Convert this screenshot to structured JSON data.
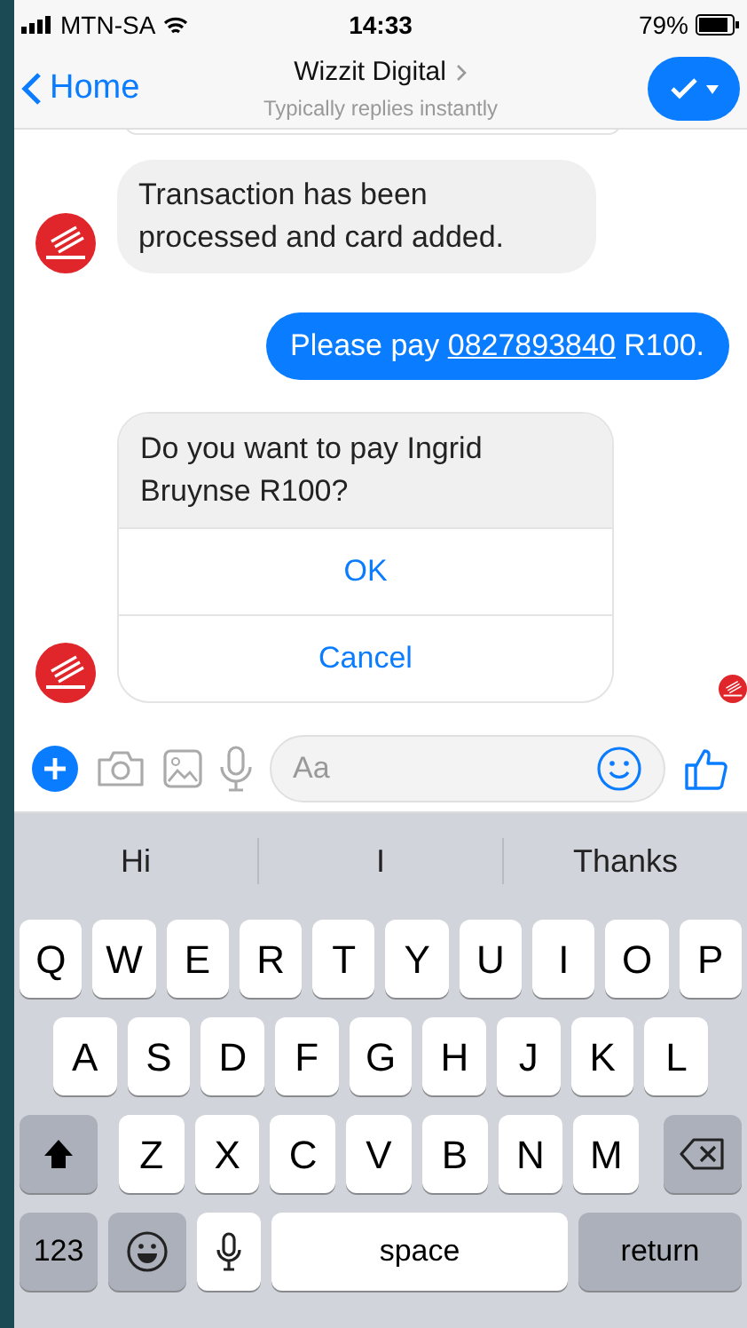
{
  "status_bar": {
    "carrier": "MTN-SA",
    "time": "14:33",
    "battery": "79%"
  },
  "header": {
    "back": "Home",
    "title": "Wizzit Digital",
    "subtitle": "Typically replies instantly"
  },
  "messages": [
    {
      "kind": "cut-card"
    },
    {
      "kind": "received",
      "text": "Transaction has been processed and card added.",
      "avatar": true
    },
    {
      "kind": "sent",
      "text": "Please pay ",
      "link": "0827893840",
      "after": " R100."
    },
    {
      "kind": "card",
      "text": "Do you want to pay Ingrid Bruynse R100?",
      "options": [
        "OK",
        "Cancel"
      ],
      "avatar": true,
      "seen": true
    }
  ],
  "composer": {
    "placeholder": "Aa"
  },
  "keyboard": {
    "suggestions": [
      "Hi",
      "I",
      "Thanks"
    ],
    "letter_rows": [
      {
        "keys": [
          "Q",
          "W",
          "E",
          "R",
          "T",
          "Y",
          "U",
          "I",
          "O",
          "P"
        ]
      },
      {
        "keys": [
          "A",
          "S",
          "D",
          "F",
          "G",
          "H",
          "J",
          "K",
          "L"
        ]
      },
      {
        "keys": [
          "Z",
          "X",
          "C",
          "V",
          "B",
          "N",
          "M"
        ]
      }
    ],
    "numbers_key": "123",
    "space_key": "space",
    "return_key": "return"
  }
}
